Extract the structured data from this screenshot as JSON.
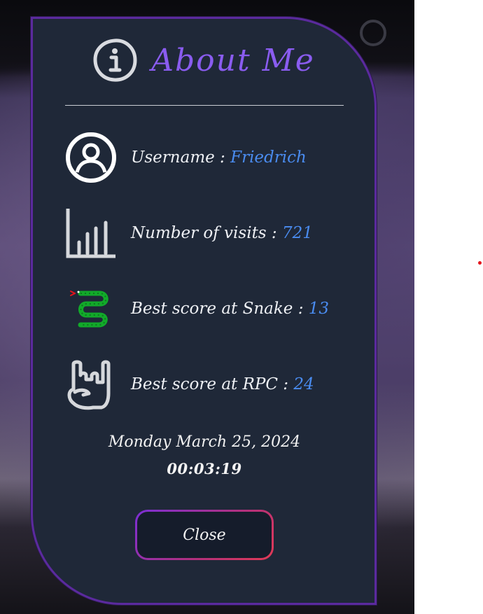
{
  "modal": {
    "title": "About Me",
    "close_label": "Close"
  },
  "profile": {
    "rows": [
      {
        "label": "Username : ",
        "value": "Friedrich",
        "icon": "user-circle-icon"
      },
      {
        "label": "Number of visits : ",
        "value": "721",
        "icon": "bar-chart-icon"
      },
      {
        "label": "Best score at Snake : ",
        "value": "13",
        "icon": "snake-icon"
      },
      {
        "label": "Best score at RPC : ",
        "value": "24",
        "icon": "rock-hand-icon"
      }
    ]
  },
  "clock": {
    "date": "Monday March 25, 2024",
    "time": "00:03:19"
  },
  "colors": {
    "title": "#8a5cf0",
    "value": "#4a8cf0",
    "card": "#1f2838",
    "border": "#5b2a9e"
  }
}
